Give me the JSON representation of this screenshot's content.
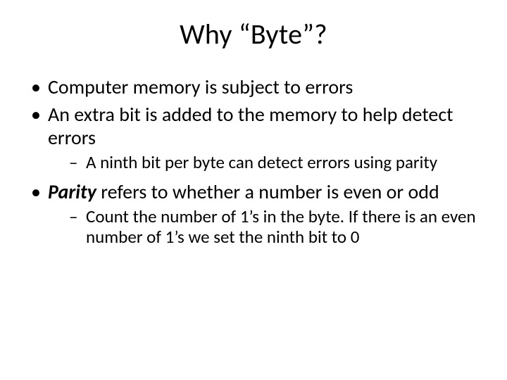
{
  "title": "Why “Byte”?",
  "bullets": {
    "b1": "Computer memory is subject to errors",
    "b2": "An extra bit is added to the memory to help detect errors",
    "b2a": "A ninth bit per byte can detect errors using parity",
    "b3_strong": "Parity",
    "b3_rest": " refers to whether a number is even or odd",
    "b3a": "Count the number of 1’s in the byte. If there is an even number of 1’s we set the ninth bit to 0"
  }
}
